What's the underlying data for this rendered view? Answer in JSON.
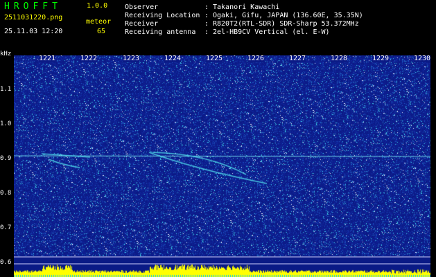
{
  "app": {
    "title": "HROFFT",
    "version": "1.0.0",
    "file_name": "2511031220.png",
    "date_time": "25.11.03 12:20",
    "meteor_label": "meteor",
    "meteor_count": "65"
  },
  "info": [
    {
      "key": "Observer",
      "value": "Takanori Kawachi"
    },
    {
      "key": "Receiving Location",
      "value": "Ogaki, Gifu, JAPAN (136.60E, 35.35N)"
    },
    {
      "key": "Receiver",
      "value": "R820T2(RTL-SDR) SDR-Sharp 53.372MHz"
    },
    {
      "key": "Receiving antenna",
      "value": "2el-HB9CV Vertical (el. E-W)"
    }
  ],
  "y_axis": {
    "unit": "kHz",
    "ticks": [
      "1.1",
      "1.0",
      "0.9",
      "0.8",
      "0.7",
      "0.6"
    ]
  },
  "x_axis": {
    "ticks": [
      "1221",
      "1222",
      "1223",
      "1224",
      "1225",
      "1226",
      "1227",
      "1228",
      "1229",
      "1230"
    ]
  },
  "colors": {
    "title": "#00ff00",
    "version": "#ffff00",
    "file_name": "#ffff00",
    "meteor_label": "#ffff00",
    "date_time": "#ffffff",
    "meteor_count": "#ffff00",
    "info_text": "#ffffff",
    "axis_text": "#ffffff",
    "background": "#000000",
    "spectro_bg": "#0a1a86",
    "bar_yellow": "#ffff00",
    "bar_cyan": "#00c8ff"
  }
}
